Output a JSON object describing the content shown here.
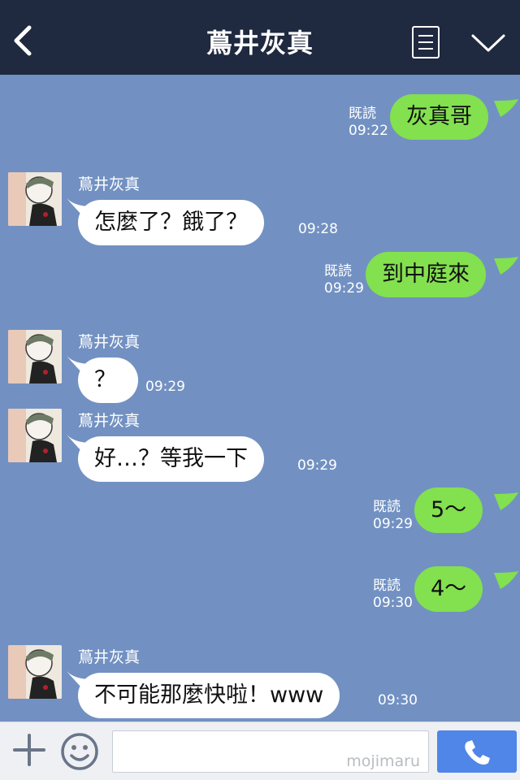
{
  "header": {
    "title": "蔦井灰真",
    "back_icon": "chevron-left-icon",
    "menu_icon": "list-icon",
    "dropdown_icon": "chevron-down-icon"
  },
  "colors": {
    "header_bg": "#1f2940",
    "chat_bg": "#7291c2",
    "outgoing_bubble": "#83e04f",
    "incoming_bubble": "#ffffff",
    "send_button": "#4f86e8"
  },
  "messages": [
    {
      "direction": "out",
      "text": "灰真哥",
      "read": "既読",
      "time": "09:22"
    },
    {
      "direction": "in",
      "sender": "蔦井灰真",
      "text": "怎麼了？餓了？",
      "time": "09:28"
    },
    {
      "direction": "out",
      "text": "到中庭來",
      "read": "既読",
      "time": "09:29"
    },
    {
      "direction": "in",
      "sender": "蔦井灰真",
      "text": "？",
      "time": "09:29"
    },
    {
      "direction": "in",
      "sender": "蔦井灰真",
      "text": "好…？等我一下",
      "time": "09:29"
    },
    {
      "direction": "out",
      "text": "5～",
      "read": "既読",
      "time": "09:29"
    },
    {
      "direction": "out",
      "text": "4～",
      "read": "既読",
      "time": "09:30"
    },
    {
      "direction": "in",
      "sender": "蔦井灰真",
      "text": "不可能那麼快啦！www",
      "time": "09:30"
    }
  ],
  "input_bar": {
    "plus_icon": "plus-icon",
    "sticker_icon": "smiley-icon",
    "watermark": "mojimaru",
    "send_icon": "phone-icon"
  }
}
